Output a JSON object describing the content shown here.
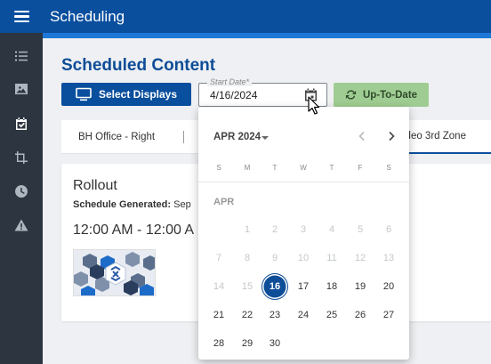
{
  "app": {
    "title": "Scheduling"
  },
  "page": {
    "title": "Scheduled Content"
  },
  "toolbar": {
    "select_displays_label": "Select Displays",
    "start_date_label": "Start Date*",
    "start_date_value": "4/16/2024",
    "uptodate_label": "Up-To-Date"
  },
  "tabs": [
    {
      "label": "BH Office - Right"
    },
    {
      "label": "ideo 3rd Zone"
    }
  ],
  "card": {
    "title": "Rollout",
    "generated_label": "Schedule Generated:",
    "generated_value": "Sep",
    "time_range": "12:00 AM - 12:00 A"
  },
  "datepicker": {
    "month_year": "APR 2024",
    "month_label": "APR",
    "weekdays": [
      "S",
      "M",
      "T",
      "W",
      "T",
      "F",
      "S"
    ],
    "selected_day": 16,
    "weeks": [
      [
        null,
        1,
        2,
        3,
        4,
        5,
        6
      ],
      [
        7,
        8,
        9,
        10,
        11,
        12,
        13
      ],
      [
        14,
        15,
        16,
        17,
        18,
        19,
        20
      ],
      [
        21,
        22,
        23,
        24,
        25,
        26,
        27
      ],
      [
        28,
        29,
        30,
        null,
        null,
        null,
        null
      ]
    ],
    "first_enabled_day": 16
  },
  "colors": {
    "brand": "#0a4f9e",
    "accent": "#1e78d6",
    "sidebar": "#2c3540",
    "uptodate_bg": "#9fcc92",
    "selected_day": "#0e4d97"
  },
  "icons": {
    "menu": "hamburger-icon",
    "sidebar": [
      "list-icon",
      "image-icon",
      "calendar-check-icon",
      "crop-icon",
      "clock-icon",
      "warning-icon"
    ],
    "select_displays": "monitor-icon",
    "date_field": "calendar-icon",
    "uptodate": "refresh-icon",
    "prev": "chevron-left-icon",
    "next": "chevron-right-icon"
  }
}
